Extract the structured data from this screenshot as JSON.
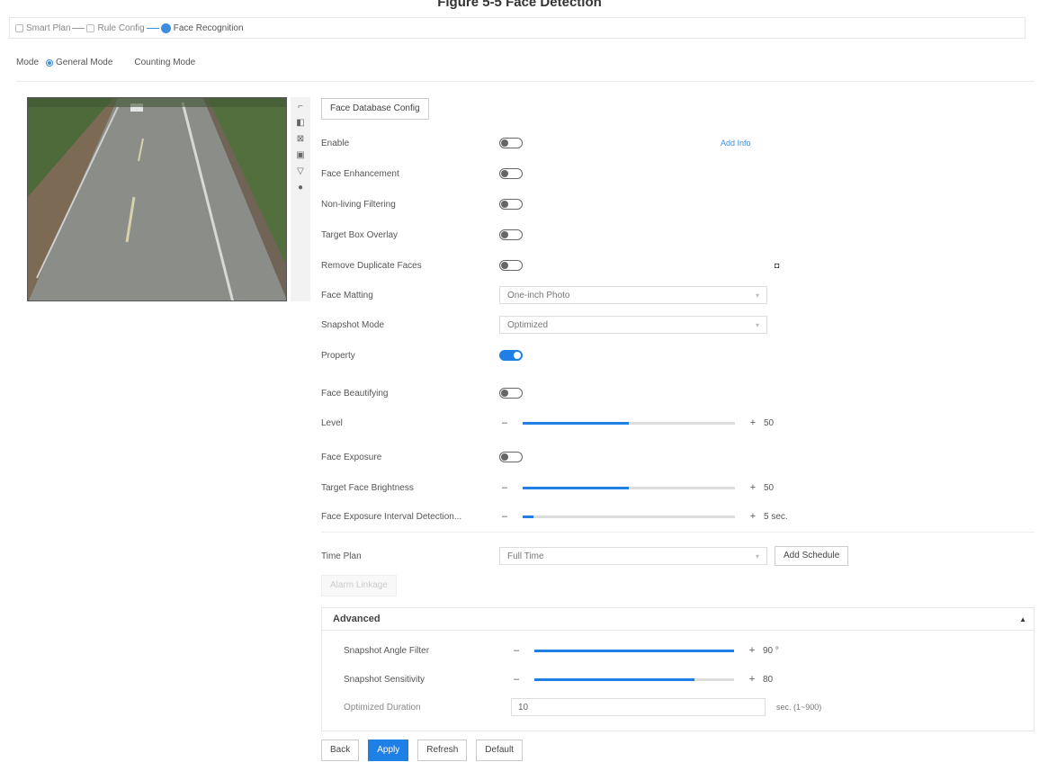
{
  "caption": "Figure 5-5 Face Detection",
  "steps": [
    {
      "label": "Smart Plan",
      "active": false
    },
    {
      "label": "Rule Config",
      "active": false
    },
    {
      "label": "Face Recognition",
      "active": true
    }
  ],
  "mode": {
    "label": "Mode",
    "options": [
      {
        "label": "General Mode",
        "selected": true
      },
      {
        "label": "Counting Mode",
        "selected": false
      }
    ]
  },
  "toolbar_icons": [
    "pointer-icon",
    "draw-area-icon",
    "draw-region-icon",
    "face-size-icon",
    "filter-icon",
    "clear-icon"
  ],
  "face_database_button": "Face Database Config",
  "fields": {
    "enable": {
      "label": "Enable",
      "on": false,
      "link": "Add Info"
    },
    "face_enhancement": {
      "label": "Face Enhancement",
      "on": false
    },
    "non_living_filtering": {
      "label": "Non-living Filtering",
      "on": false
    },
    "target_box_overlay": {
      "label": "Target Box Overlay",
      "on": false
    },
    "remove_duplicate_faces": {
      "label": "Remove Duplicate Faces",
      "on": false
    },
    "face_matting": {
      "label": "Face Matting",
      "value": "One-inch Photo"
    },
    "snapshot_mode": {
      "label": "Snapshot Mode",
      "value": "Optimized"
    },
    "property": {
      "label": "Property",
      "on": true
    },
    "face_beautifying": {
      "label": "Face Beautifying",
      "on": false
    },
    "level": {
      "label": "Level",
      "value": 50,
      "fill": 0.5
    },
    "face_exposure": {
      "label": "Face Exposure",
      "on": false
    },
    "target_face_brightness": {
      "label": "Target Face Brightness",
      "value": 50,
      "fill": 0.5
    },
    "face_exposure_interval": {
      "label": "Face Exposure Interval Detection...",
      "value": "5 sec.",
      "fill": 0.05
    },
    "time_plan": {
      "label": "Time Plan",
      "value": "Full Time",
      "add_button": "Add Schedule"
    },
    "action_button": "Alarm Linkage"
  },
  "advanced": {
    "title": "Advanced",
    "snapshot_angle_filter": {
      "label": "Snapshot Angle Filter",
      "value": "90 °",
      "fill": 1.0
    },
    "snapshot_sensitivity": {
      "label": "Snapshot Sensitivity",
      "value": "80",
      "fill": 0.8
    },
    "optimized_duration": {
      "label": "Optimized Duration",
      "value": "10",
      "unit": "sec. (1~900)"
    }
  },
  "buttons": {
    "back": "Back",
    "apply": "Apply",
    "refresh": "Refresh",
    "default": "Default"
  },
  "colors": {
    "accent": "#1e7fe6",
    "step_active": "#3b8de0"
  }
}
